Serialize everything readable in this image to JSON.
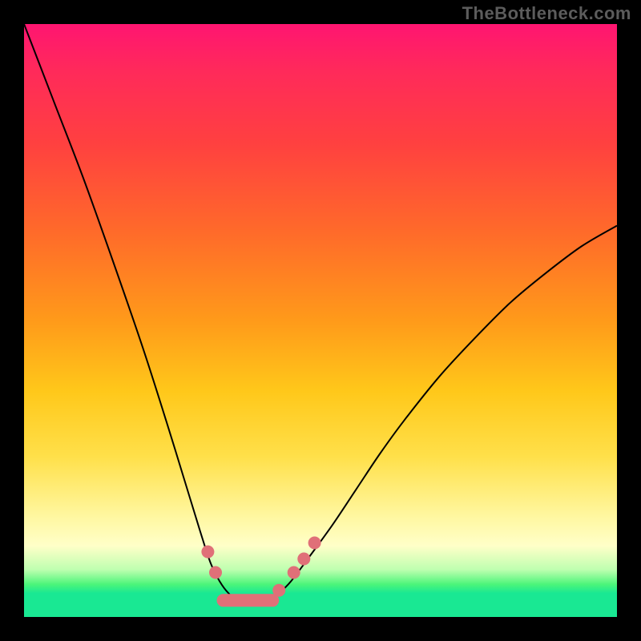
{
  "watermark": "TheBottleneck.com",
  "chart_data": {
    "type": "line",
    "title": "",
    "xlabel": "",
    "ylabel": "",
    "note": "Axes have no visible tick labels. X is normalized 0..1 across the plot width; Y is normalized 0..1 from bottom (0) to top (1). Values are read from pixel positions of the black curve.",
    "xlim": [
      0,
      1
    ],
    "ylim": [
      0,
      1
    ],
    "series": [
      {
        "name": "bottleneck-curve",
        "x": [
          0.0,
          0.05,
          0.1,
          0.15,
          0.2,
          0.24,
          0.28,
          0.3,
          0.315,
          0.33,
          0.345,
          0.36,
          0.415,
          0.43,
          0.45,
          0.48,
          0.52,
          0.56,
          0.6,
          0.64,
          0.7,
          0.76,
          0.82,
          0.88,
          0.94,
          1.0
        ],
        "y": [
          1.0,
          0.87,
          0.74,
          0.6,
          0.455,
          0.33,
          0.2,
          0.135,
          0.09,
          0.06,
          0.04,
          0.03,
          0.03,
          0.04,
          0.06,
          0.1,
          0.155,
          0.215,
          0.275,
          0.33,
          0.405,
          0.47,
          0.53,
          0.58,
          0.625,
          0.66
        ]
      }
    ],
    "markers": {
      "name": "highlight-dots",
      "x": [
        0.31,
        0.323,
        0.43,
        0.455,
        0.472,
        0.49
      ],
      "y": [
        0.11,
        0.075,
        0.045,
        0.075,
        0.098,
        0.125
      ],
      "r": [
        8,
        8,
        8,
        8,
        8,
        8
      ]
    },
    "valley_bar": {
      "x0": 0.325,
      "x1": 0.43,
      "y": 0.028,
      "thickness_px": 16
    },
    "colors": {
      "curve": "#000000",
      "marker": "#e07078",
      "gradient_top": "#ff1571",
      "gradient_mid": "#ffe04a",
      "gradient_bottom": "#19e893",
      "frame": "#000000"
    }
  }
}
